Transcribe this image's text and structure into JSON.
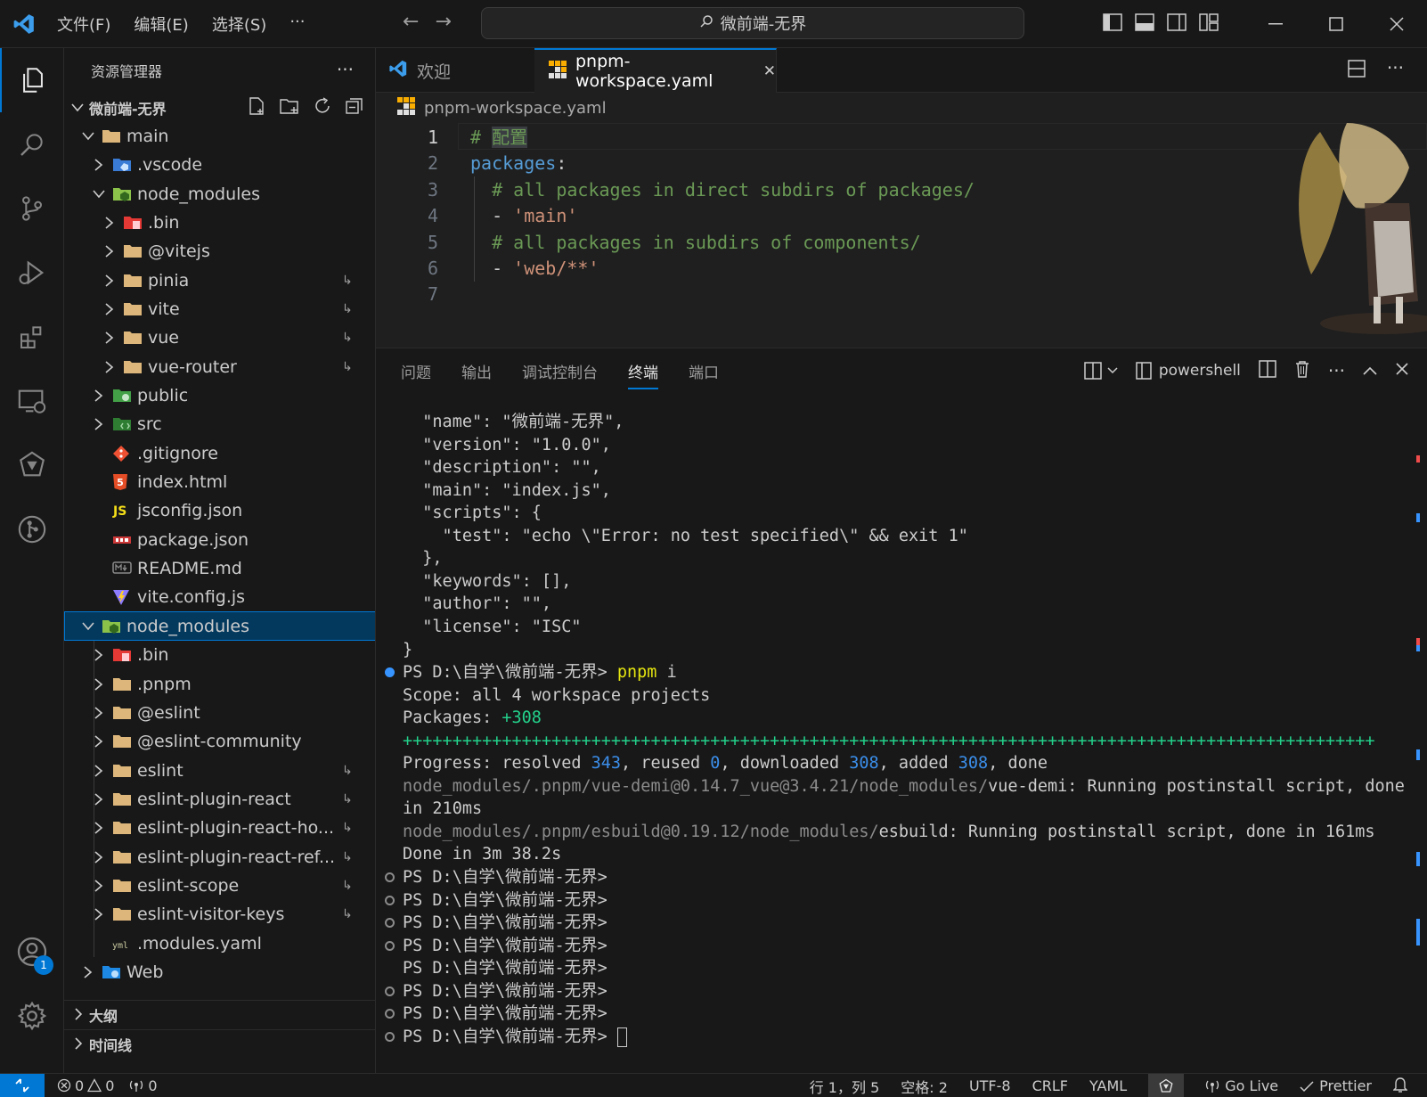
{
  "titlebar": {
    "menu": [
      "文件(F)",
      "编辑(E)",
      "选择(S)",
      "···"
    ],
    "search": "微前端-无界"
  },
  "sidebar": {
    "title": "资源管理器",
    "more": "···",
    "tree": [
      {
        "label": "微前端-无界",
        "level": 0,
        "kind": "root",
        "open": true
      },
      {
        "label": "main",
        "level": 1,
        "kind": "folder",
        "open": true
      },
      {
        "label": ".vscode",
        "level": 2,
        "kind": "folder-vscode",
        "open": false
      },
      {
        "label": "node_modules",
        "level": 2,
        "kind": "folder-node",
        "open": true
      },
      {
        "label": ".bin",
        "level": 3,
        "kind": "folder-bin",
        "open": false
      },
      {
        "label": "@vitejs",
        "level": 3,
        "kind": "folder",
        "open": false
      },
      {
        "label": "pinia",
        "level": 3,
        "kind": "folder",
        "open": false,
        "link": "↳"
      },
      {
        "label": "vite",
        "level": 3,
        "kind": "folder",
        "open": false,
        "link": "↳"
      },
      {
        "label": "vue",
        "level": 3,
        "kind": "folder",
        "open": false,
        "link": "↳"
      },
      {
        "label": "vue-router",
        "level": 3,
        "kind": "folder",
        "open": false,
        "link": "↳"
      },
      {
        "label": "public",
        "level": 2,
        "kind": "folder-public",
        "open": false
      },
      {
        "label": "src",
        "level": 2,
        "kind": "folder-src",
        "open": false
      },
      {
        "label": ".gitignore",
        "level": 2,
        "kind": "file-git"
      },
      {
        "label": "index.html",
        "level": 2,
        "kind": "file-html"
      },
      {
        "label": "jsconfig.json",
        "level": 2,
        "kind": "file-js"
      },
      {
        "label": "package.json",
        "level": 2,
        "kind": "file-npm"
      },
      {
        "label": "README.md",
        "level": 2,
        "kind": "file-md"
      },
      {
        "label": "vite.config.js",
        "level": 2,
        "kind": "file-vite"
      },
      {
        "label": "node_modules",
        "level": 1,
        "kind": "folder-node",
        "open": true,
        "selected": true
      },
      {
        "label": ".bin",
        "level": 2,
        "kind": "folder-bin",
        "open": false
      },
      {
        "label": ".pnpm",
        "level": 2,
        "kind": "folder",
        "open": false
      },
      {
        "label": "@eslint",
        "level": 2,
        "kind": "folder",
        "open": false
      },
      {
        "label": "@eslint-community",
        "level": 2,
        "kind": "folder",
        "open": false
      },
      {
        "label": "eslint",
        "level": 2,
        "kind": "folder",
        "open": false,
        "link": "↳"
      },
      {
        "label": "eslint-plugin-react",
        "level": 2,
        "kind": "folder",
        "open": false,
        "link": "↳"
      },
      {
        "label": "eslint-plugin-react-ho...",
        "level": 2,
        "kind": "folder",
        "open": false,
        "link": "↳"
      },
      {
        "label": "eslint-plugin-react-ref...",
        "level": 2,
        "kind": "folder",
        "open": false,
        "link": "↳"
      },
      {
        "label": "eslint-scope",
        "level": 2,
        "kind": "folder",
        "open": false,
        "link": "↳"
      },
      {
        "label": "eslint-visitor-keys",
        "level": 2,
        "kind": "folder",
        "open": false,
        "link": "↳"
      },
      {
        "label": ".modules.yaml",
        "level": 2,
        "kind": "file-yaml"
      },
      {
        "label": "Web",
        "level": 1,
        "kind": "folder-web",
        "open": false
      }
    ],
    "outline": "大纲",
    "timeline": "时间线"
  },
  "activity": {
    "accounts_badge": "1"
  },
  "editor": {
    "tabs": [
      {
        "label": "欢迎",
        "active": false
      },
      {
        "label": "pnpm-workspace.yaml",
        "active": true,
        "close": "✕"
      }
    ],
    "breadcrumb": "pnpm-workspace.yaml",
    "lines": [
      {
        "n": "1",
        "parts": [
          {
            "t": "# ",
            "c": "com"
          },
          {
            "t": "配置",
            "c": "com"
          }
        ]
      },
      {
        "n": "2",
        "parts": [
          {
            "t": "packages",
            "c": "key"
          },
          {
            "t": ":",
            "c": "pun"
          }
        ]
      },
      {
        "n": "3",
        "parts": [
          {
            "t": "  # all packages in direct subdirs of packages/",
            "c": "com"
          }
        ]
      },
      {
        "n": "4",
        "parts": [
          {
            "t": "  - ",
            "c": "pun"
          },
          {
            "t": "'main'",
            "c": "str"
          }
        ]
      },
      {
        "n": "5",
        "parts": [
          {
            "t": "  # all packages in subdirs of components/",
            "c": "com"
          }
        ]
      },
      {
        "n": "6",
        "parts": [
          {
            "t": "  - ",
            "c": "pun"
          },
          {
            "t": "'web/**'",
            "c": "str"
          }
        ]
      },
      {
        "n": "7",
        "parts": []
      }
    ]
  },
  "panel": {
    "tabs": [
      "问题",
      "输出",
      "调试控制台",
      "终端",
      "端口"
    ],
    "active_tab": "终端",
    "shell": "powershell",
    "terminal": [
      {
        "dot": "",
        "parts": [
          {
            "t": "  \"name\": \"微前端-无界\",",
            "c": ""
          }
        ]
      },
      {
        "dot": "",
        "parts": [
          {
            "t": "  \"version\": \"1.0.0\",",
            "c": ""
          }
        ]
      },
      {
        "dot": "",
        "parts": [
          {
            "t": "  \"description\": \"\",",
            "c": ""
          }
        ]
      },
      {
        "dot": "",
        "parts": [
          {
            "t": "  \"main\": \"index.js\",",
            "c": ""
          }
        ]
      },
      {
        "dot": "",
        "parts": [
          {
            "t": "  \"scripts\": {",
            "c": ""
          }
        ]
      },
      {
        "dot": "",
        "parts": [
          {
            "t": "    \"test\": \"echo \\\"Error: no test specified\\\" && exit 1\"",
            "c": ""
          }
        ]
      },
      {
        "dot": "",
        "parts": [
          {
            "t": "  },",
            "c": ""
          }
        ]
      },
      {
        "dot": "",
        "parts": [
          {
            "t": "  \"keywords\": [],",
            "c": ""
          }
        ]
      },
      {
        "dot": "",
        "parts": [
          {
            "t": "  \"author\": \"\",",
            "c": ""
          }
        ]
      },
      {
        "dot": "",
        "parts": [
          {
            "t": "  \"license\": \"ISC\"",
            "c": ""
          }
        ]
      },
      {
        "dot": "",
        "parts": [
          {
            "t": "}",
            "c": ""
          }
        ]
      },
      {
        "dot": "fill",
        "parts": [
          {
            "t": "PS D:\\自学\\微前端-无界> ",
            "c": ""
          },
          {
            "t": "pnpm",
            "c": "y"
          },
          {
            "t": " i",
            "c": ""
          }
        ]
      },
      {
        "dot": "",
        "parts": [
          {
            "t": "Scope: all 4 workspace projects",
            "c": ""
          }
        ]
      },
      {
        "dot": "",
        "parts": [
          {
            "t": "Packages: ",
            "c": ""
          },
          {
            "t": "+308",
            "c": "g"
          }
        ]
      },
      {
        "dot": "",
        "parts": [
          {
            "t": "++++++++++++++++++++++++++++++++++++++++++++++++++++++++++++++++++++++++++++++++++++++++++++++++++",
            "c": "g"
          }
        ]
      },
      {
        "dot": "",
        "parts": [
          {
            "t": "Progress: resolved ",
            "c": ""
          },
          {
            "t": "343",
            "c": "b"
          },
          {
            "t": ", reused ",
            "c": ""
          },
          {
            "t": "0",
            "c": "b"
          },
          {
            "t": ", downloaded ",
            "c": ""
          },
          {
            "t": "308",
            "c": "b"
          },
          {
            "t": ", added ",
            "c": ""
          },
          {
            "t": "308",
            "c": "b"
          },
          {
            "t": ", done",
            "c": ""
          }
        ]
      },
      {
        "dot": "",
        "parts": [
          {
            "t": "node_modules/.pnpm/vue-demi@0.14.7_vue@3.4.21/node_modules/",
            "c": "d"
          },
          {
            "t": "vue-demi: Running postinstall script, done",
            "c": ""
          }
        ]
      },
      {
        "dot": "",
        "parts": [
          {
            "t": "in 210ms",
            "c": ""
          }
        ]
      },
      {
        "dot": "",
        "parts": [
          {
            "t": "node_modules/.pnpm/esbuild@0.19.12/node_modules/",
            "c": "d"
          },
          {
            "t": "esbuild: Running postinstall script, done in 161ms",
            "c": ""
          }
        ]
      },
      {
        "dot": "",
        "parts": [
          {
            "t": "Done in 3m 38.2s",
            "c": ""
          }
        ]
      },
      {
        "dot": "ring",
        "parts": [
          {
            "t": "PS D:\\自学\\微前端-无界>",
            "c": ""
          }
        ]
      },
      {
        "dot": "ring",
        "parts": [
          {
            "t": "PS D:\\自学\\微前端-无界>",
            "c": ""
          }
        ]
      },
      {
        "dot": "ring",
        "parts": [
          {
            "t": "PS D:\\自学\\微前端-无界>",
            "c": ""
          }
        ]
      },
      {
        "dot": "ring",
        "parts": [
          {
            "t": "PS D:\\自学\\微前端-无界>",
            "c": ""
          }
        ]
      },
      {
        "dot": "",
        "parts": [
          {
            "t": "PS D:\\自学\\微前端-无界>",
            "c": ""
          }
        ]
      },
      {
        "dot": "ring",
        "parts": [
          {
            "t": "PS D:\\自学\\微前端-无界>",
            "c": ""
          }
        ]
      },
      {
        "dot": "ring",
        "parts": [
          {
            "t": "PS D:\\自学\\微前端-无界>",
            "c": ""
          }
        ]
      },
      {
        "dot": "ring",
        "parts": [
          {
            "t": "PS D:\\自学\\微前端-无界> ",
            "c": ""
          }
        ],
        "cursor": true
      }
    ]
  },
  "status": {
    "errors": "0",
    "warnings": "0",
    "ports": "0",
    "position": "行 1，列 5",
    "indent": "空格: 2",
    "encoding": "UTF-8",
    "eol": "CRLF",
    "language": "YAML",
    "golive": "Go Live",
    "prettier": "Prettier"
  },
  "colors": {
    "accent": "#0078d4",
    "comment": "#6a9955",
    "keyword": "#569cd6",
    "string": "#ce9178",
    "folder": "#dcb67a"
  }
}
